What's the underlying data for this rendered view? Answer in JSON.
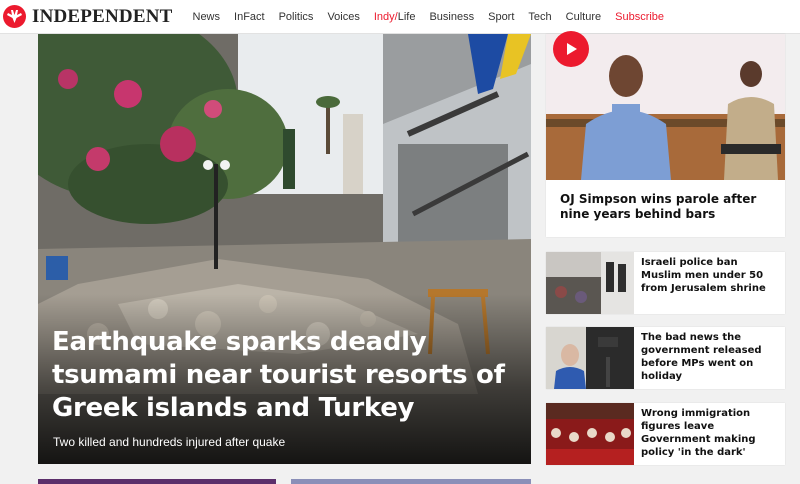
{
  "brand": {
    "name": "INDEPENDENT",
    "accent": "#ec1a2e"
  },
  "nav": {
    "items": [
      "News",
      "InFact",
      "Politics",
      "Voices"
    ],
    "indy_red": "Indy/",
    "indy_rest": "Life",
    "items2": [
      "Business",
      "Sport",
      "Tech",
      "Culture"
    ],
    "subscribe": "Subscribe"
  },
  "hero": {
    "title": "Earthquake sparks deadly tsumami near tourist resorts of Greek islands and Turkey",
    "subtitle": "Two killed and hundreds injured after quake"
  },
  "featured": {
    "title": "OJ Simpson wins parole after nine years behind bars",
    "icon": "play-icon"
  },
  "stories": [
    {
      "title": "Israeli police ban Muslim men under 50 from Jerusalem shrine"
    },
    {
      "title": "The bad news the government released before MPs went on holiday"
    },
    {
      "title": "Wrong immigration figures leave Government making policy 'in the dark'"
    }
  ]
}
